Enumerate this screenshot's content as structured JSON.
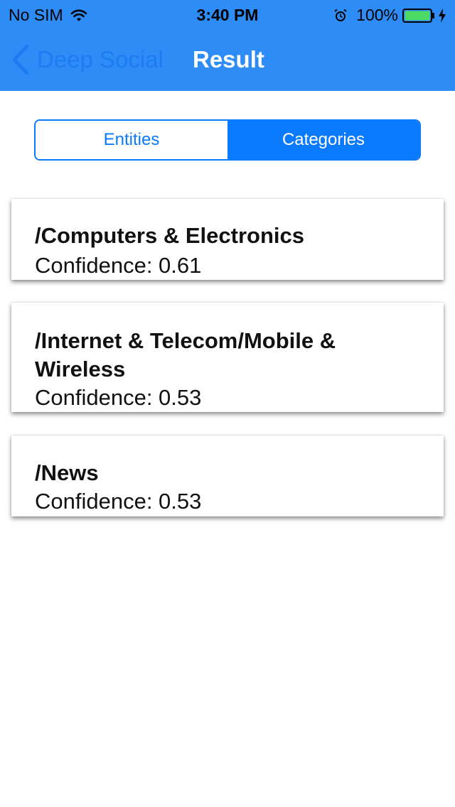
{
  "status_bar": {
    "carrier": "No SIM",
    "time": "3:40 PM",
    "battery_percent": "100%"
  },
  "nav": {
    "back_label": "Deep Social",
    "title": "Result"
  },
  "segments": {
    "entities_label": "Entities",
    "categories_label": "Categories",
    "selected": "Categories"
  },
  "results": [
    {
      "category": "/Computers & Electronics",
      "confidence": "Confidence: 0.61"
    },
    {
      "category": "/Internet & Telecom/Mobile & Wireless",
      "confidence": "Confidence: 0.53"
    },
    {
      "category": "/News",
      "confidence": "Confidence: 0.53"
    }
  ],
  "colors": {
    "header_bg": "#2d8cf6",
    "accent": "#0a7aff",
    "back_label": "#1e7bf2"
  }
}
